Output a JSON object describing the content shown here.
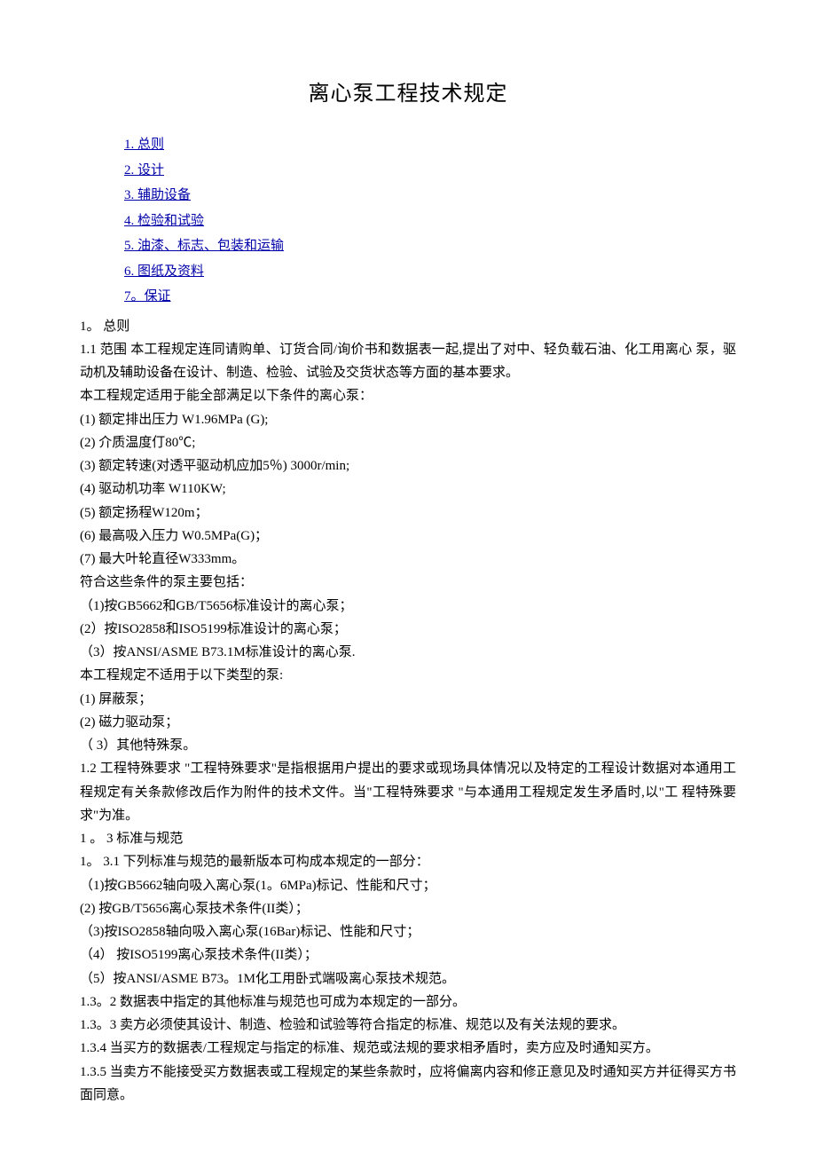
{
  "title": "离心泵工程技术规定",
  "toc": {
    "i1": "1. 总则",
    "i2": "2. 设计",
    "i3": "3. 辅助设备",
    "i4": "4.     检验和试验",
    "i5": "5.     油漆、标志、包装和运输",
    "i6": "6.     图纸及资料",
    "i7": "7。保证"
  },
  "sec1_head": "1。  总则",
  "sec1_1": "1.1   范围   本工程规定连同请购单、订货合同/询价书和数据表一起,提出了对中、轻负载石油、化工用离心 泵，驱动机及辅助设备在设计、制造、检验、试验及交货状态等方面的基本要求。",
  "scope_intro": "本工程规定适用于能全部满足以下条件的离心泵：",
  "cond": {
    "c1": "(1)    额定排出压力 W1.96MPa (G);",
    "c2": " (2)  介质温度仃80℃;",
    "c3": "(3)    额定转速(对透平驱动机应加5％) 3000r/min;",
    "c4": " (4)    驱动机功率 W110KW;",
    "c5": "(5)    额定扬程W120m；",
    "c6": "(6)  最高吸入压力 W0.5MPa(G)；",
    "c7": "(7)  最大叶轮直径W333mm。"
  },
  "include_intro": "符合这些条件的泵主要包括：",
  "inc": {
    "i1": "（1)按GB5662和GB/T5656标准设计的离心泵；",
    "i2": "(2）按ISO2858和ISO5199标准设计的离心泵；",
    "i3": "（3）按ANSI/ASME B73.1M标准设计的离心泵."
  },
  "exclude_intro": "本工程规定不适用于以下类型的泵:",
  "exc": {
    "e1": "(1)    屏蔽泵；",
    "e2": "(2)    磁力驱动泵；",
    "e3": "（ 3）其他特殊泵。"
  },
  "sec1_2": "1.2 工程特殊要求  \"工程特殊要求\"是指根据用户提出的要求或现场具体情况以及特定的工程设计数据对本通用工 程规定有关条款修改后作为附件的技术文件。当\"工程特殊要求 \"与本通用工程规定发生矛盾时,以\"工 程特殊要求\"为准。",
  "sec1_3_head": "1 。 3 标准与规范",
  "sec1_3_1_head": "1。  3.1 下列标准与规范的最新版本可构成本规定的一部分：",
  "std": {
    "s1": "（1)按GB5662轴向吸入离心泵(1。6MPa)标记、性能和尺寸；",
    "s2": "(2) 按GB/T5656离心泵技术条件(II类）；",
    "s3": "（3)按ISO2858轴向吸入离心泵(16Bar)标记、性能和尺寸；",
    "s4": "（4） 按ISO5199离心泵技术条件(II类）；",
    "s5": "（5）按ANSI/ASME B73。1M化工用卧式端吸离心泵技术规范。"
  },
  "sec1_3_2": "1.3。2 数据表中指定的其他标准与规范也可成为本规定的一部分。",
  "sec1_3_3": "1.3。3 卖方必须使其设计、制造、检验和试验等符合指定的标准、规范以及有关法规的要求。",
  "sec1_3_4": "1.3.4  当买方的数据表/工程规定与指定的标准、规范或法规的要求相矛盾时，卖方应及时通知买方。",
  "sec1_3_5": "1.3.5  当卖方不能接受买方数据表或工程规定的某些条款时，应将偏离内容和修正意见及时通知买方并征得买方书面同意。"
}
